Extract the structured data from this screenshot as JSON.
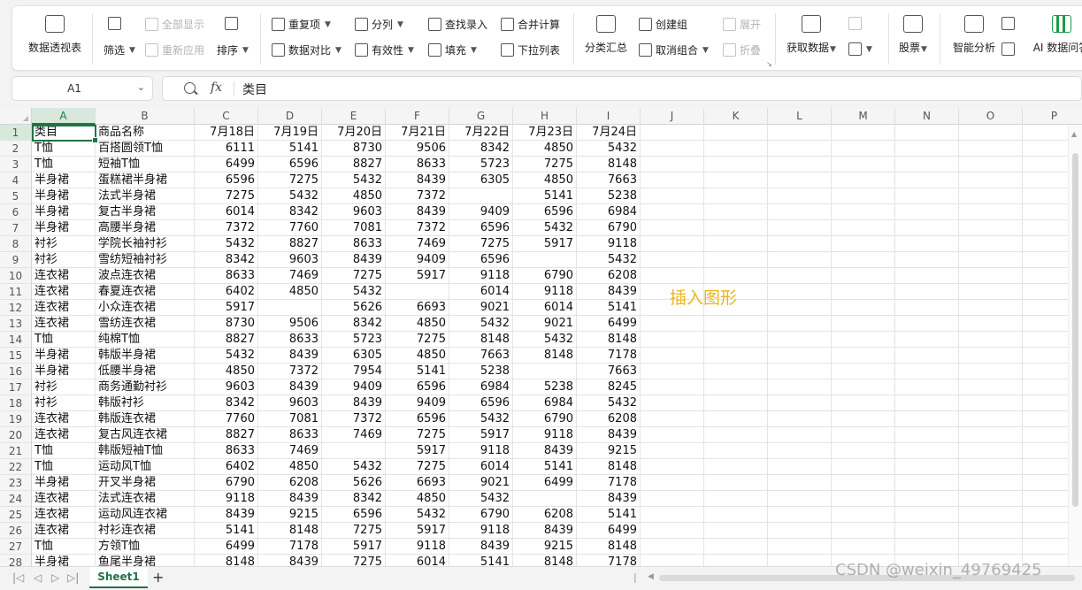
{
  "ribbon": {
    "pivot": "数据透视表",
    "filter": "筛选",
    "show_all": "全部显示",
    "reapply": "重新应用",
    "sort": "排序",
    "duplicates": "重复项",
    "compare": "数据对比",
    "split": "分列",
    "validity": "有效性",
    "lookup": "查找录入",
    "fill": "填充",
    "merge_calc": "合并计算",
    "dropdown_list": "下拉列表",
    "subtotal": "分类汇总",
    "create_group": "创建组",
    "ungroup": "取消组合",
    "expand": "展开",
    "collapse": "折叠",
    "get_data": "获取数据",
    "stocks": "股票",
    "smart_analysis": "智能分析",
    "ai_data": "AI 数据问答"
  },
  "formula_bar": {
    "name_box": "A1",
    "fx": "fx",
    "value": "类目"
  },
  "columns": [
    "A",
    "B",
    "C",
    "D",
    "E",
    "F",
    "G",
    "H",
    "I",
    "J",
    "K",
    "L",
    "M",
    "N",
    "O",
    "P"
  ],
  "rows": [
    [
      "类目",
      "商品名称",
      "7月18日",
      "7月19日",
      "7月20日",
      "7月21日",
      "7月22日",
      "7月23日",
      "7月24日"
    ],
    [
      "T恤",
      "百搭圆领T恤",
      "6111",
      "5141",
      "8730",
      "9506",
      "8342",
      "4850",
      "5432"
    ],
    [
      "T恤",
      "短袖T恤",
      "6499",
      "6596",
      "8827",
      "8633",
      "5723",
      "7275",
      "8148"
    ],
    [
      "半身裙",
      "蛋糕裙半身裙",
      "6596",
      "7275",
      "5432",
      "8439",
      "6305",
      "4850",
      "7663"
    ],
    [
      "半身裙",
      "法式半身裙",
      "7275",
      "5432",
      "4850",
      "7372",
      "",
      "5141",
      "5238"
    ],
    [
      "半身裙",
      "复古半身裙",
      "6014",
      "8342",
      "9603",
      "8439",
      "9409",
      "6596",
      "6984"
    ],
    [
      "半身裙",
      "高腰半身裙",
      "7372",
      "7760",
      "7081",
      "7372",
      "6596",
      "5432",
      "6790"
    ],
    [
      "衬衫",
      "学院长袖衬衫",
      "5432",
      "8827",
      "8633",
      "7469",
      "7275",
      "5917",
      "9118"
    ],
    [
      "衬衫",
      "雪纺短袖衬衫",
      "8342",
      "9603",
      "8439",
      "9409",
      "6596",
      "",
      "5432"
    ],
    [
      "连衣裙",
      "波点连衣裙",
      "8633",
      "7469",
      "7275",
      "5917",
      "9118",
      "6790",
      "6208"
    ],
    [
      "连衣裙",
      "春夏连衣裙",
      "6402",
      "4850",
      "5432",
      "",
      "6014",
      "9118",
      "8439"
    ],
    [
      "连衣裙",
      "小众连衣裙",
      "5917",
      "",
      "5626",
      "6693",
      "9021",
      "6014",
      "5141"
    ],
    [
      "连衣裙",
      "雪纺连衣裙",
      "8730",
      "9506",
      "8342",
      "4850",
      "5432",
      "9021",
      "6499"
    ],
    [
      "T恤",
      "纯棉T恤",
      "8827",
      "8633",
      "5723",
      "7275",
      "8148",
      "5432",
      "8148"
    ],
    [
      "半身裙",
      "韩版半身裙",
      "5432",
      "8439",
      "6305",
      "4850",
      "7663",
      "8148",
      "7178"
    ],
    [
      "半身裙",
      "低腰半身裙",
      "4850",
      "7372",
      "7954",
      "5141",
      "5238",
      "",
      "7663"
    ],
    [
      "衬衫",
      "商务通勤衬衫",
      "9603",
      "8439",
      "9409",
      "6596",
      "6984",
      "5238",
      "8245"
    ],
    [
      "衬衫",
      "韩版衬衫",
      "8342",
      "9603",
      "8439",
      "9409",
      "6596",
      "6984",
      "5432"
    ],
    [
      "连衣裙",
      "韩版连衣裙",
      "7760",
      "7081",
      "7372",
      "6596",
      "5432",
      "6790",
      "6208"
    ],
    [
      "连衣裙",
      "复古风连衣裙",
      "8827",
      "8633",
      "7469",
      "7275",
      "5917",
      "9118",
      "8439"
    ],
    [
      "T恤",
      "韩版短袖T恤",
      "8633",
      "7469",
      "",
      "5917",
      "9118",
      "8439",
      "9215"
    ],
    [
      "T恤",
      "运动风T恤",
      "6402",
      "4850",
      "5432",
      "7275",
      "6014",
      "5141",
      "8148"
    ],
    [
      "半身裙",
      "开叉半身裙",
      "6790",
      "6208",
      "5626",
      "6693",
      "9021",
      "6499",
      "7178"
    ],
    [
      "连衣裙",
      "法式连衣裙",
      "9118",
      "8439",
      "8342",
      "4850",
      "5432",
      "",
      "8439"
    ],
    [
      "连衣裙",
      "运动风连衣裙",
      "8439",
      "9215",
      "6596",
      "5432",
      "6790",
      "6208",
      "5141"
    ],
    [
      "连衣裙",
      "衬衫连衣裙",
      "5141",
      "8148",
      "7275",
      "5917",
      "9118",
      "8439",
      "6499"
    ],
    [
      "T恤",
      "方领T恤",
      "6499",
      "7178",
      "5917",
      "9118",
      "8439",
      "9215",
      "8148"
    ],
    [
      "半身裙",
      "鱼尾半身裙",
      "8148",
      "8439",
      "7275",
      "6014",
      "5141",
      "8148",
      "7178"
    ]
  ],
  "floating_text": "插入图形",
  "sheet_tab": "Sheet1",
  "watermark": "CSDN @weixin_49769425"
}
